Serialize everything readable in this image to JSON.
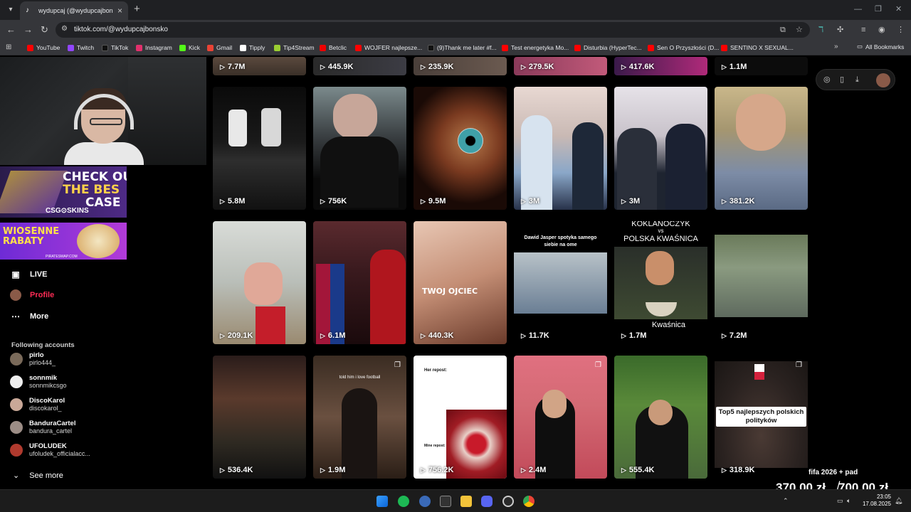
{
  "browser": {
    "tab_title": "wydupcaj (@wydupcajbonsko)",
    "url": "tiktok.com/@wydupcajbonsko",
    "bookmarks": [
      "YouTube",
      "Twitch",
      "TikTok",
      "Instagram",
      "Kick",
      "Gmail",
      "Tipply",
      "Tip4Stream",
      "Betclic",
      "WOJFER najlepsze...",
      "(9)Thank me later #f...",
      "Test energetyka Mo...",
      "Disturbia (HyperTec...",
      "Sen O Przyszłości (D...",
      "SENTINO X SEXUAL..."
    ],
    "all_bookmarks": "All Bookmarks"
  },
  "ads": {
    "ad1_line1": "CHECK OU",
    "ad1_line2": "THE BES",
    "ad1_line3": "CASE",
    "ad1_brand": "CSG⊙SKINS",
    "ad2_line1": "WIOSENNE",
    "ad2_line2": "RABATY",
    "ad2_footer": "PIRATESWAP.COM"
  },
  "sidebar": {
    "nav": [
      {
        "label": "LIVE"
      },
      {
        "label": "Profile"
      },
      {
        "label": "More"
      }
    ],
    "following_header": "Following accounts",
    "accounts": [
      {
        "name": "pirlo",
        "handle": "pirlo444_"
      },
      {
        "name": "sonnmik",
        "handle": "sonnmikcsgo"
      },
      {
        "name": "DiscoKarol",
        "handle": "discokarol_"
      },
      {
        "name": "BanduraCartel",
        "handle": "bandura_cartel"
      },
      {
        "name": "UFOLUDEK",
        "handle": "ufoludek_officialacc..."
      }
    ],
    "see_more": "See more"
  },
  "videos": {
    "row0": [
      "7.7M",
      "445.9K",
      "235.9K",
      "279.5K",
      "417.6K",
      "1.1M"
    ],
    "row1": [
      "5.8M",
      "756K",
      "9.5M",
      "3M",
      "3M",
      "381.2K"
    ],
    "row2": [
      "209.1K",
      "6.1M",
      "440.3K",
      "11.7K",
      "1.7M",
      "7.2M"
    ],
    "row3": [
      "536.4K",
      "1.9M",
      "756.2K",
      "2.4M",
      "555.4K",
      "318.9K"
    ],
    "overlays": {
      "r2c2": "TWOJ OJCIEC",
      "r2c3a": "Dawid Jasper spotyka samego",
      "r2c3b": "siebie na ome",
      "r2c4a": "KOKLANOCZYK",
      "r2c4b": "vs",
      "r2c4c": "POLSKA KWAŚNICA",
      "r2c4d": "Kwaśnica",
      "r3c1": "told him i love football",
      "r3c2a": "Her repost:",
      "r3c2b": "Mine repost:",
      "r3c5a": "Top5 najlepszych polskich",
      "r3c5b": "polityków"
    }
  },
  "stream_overlay": {
    "label": "fifa 2026 + pad",
    "price_current": "370,00 zł",
    "separator": "/",
    "price_goal": "700,00 zł"
  },
  "taskbar": {
    "time": "23:05",
    "date": "17.08.2025"
  },
  "colors": {
    "tiktok_red": "#fe2c55",
    "chrome_dark": "#35363a",
    "page_bg": "#000000"
  }
}
